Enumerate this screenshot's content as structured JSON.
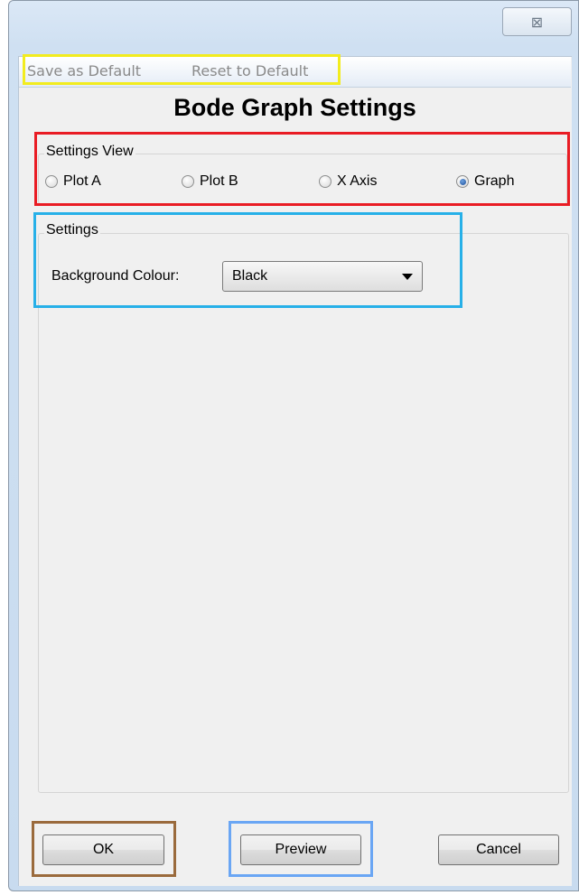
{
  "window": {
    "close_label": "⊠"
  },
  "menu": {
    "items": [
      {
        "label": "Save as Default"
      },
      {
        "label": "Reset to Default"
      }
    ]
  },
  "dialog": {
    "title": "Bode Graph Settings"
  },
  "settings_view": {
    "legend": "Settings View",
    "options": [
      {
        "label": "Plot A",
        "selected": false
      },
      {
        "label": "Plot B",
        "selected": false
      },
      {
        "label": "X Axis",
        "selected": false
      },
      {
        "label": "Graph",
        "selected": true
      }
    ]
  },
  "settings": {
    "legend": "Settings",
    "background_colour_label": "Background Colour:",
    "background_colour_value": "Black"
  },
  "buttons": {
    "ok": "OK",
    "preview": "Preview",
    "cancel": "Cancel"
  },
  "annotation_colors": {
    "menu_highlight": "#f2ec1f",
    "settings_view_highlight": "#e91c24",
    "settings_highlight": "#27b0e8",
    "ok_highlight": "#9a6a3c",
    "preview_highlight": "#6aa6f4"
  }
}
